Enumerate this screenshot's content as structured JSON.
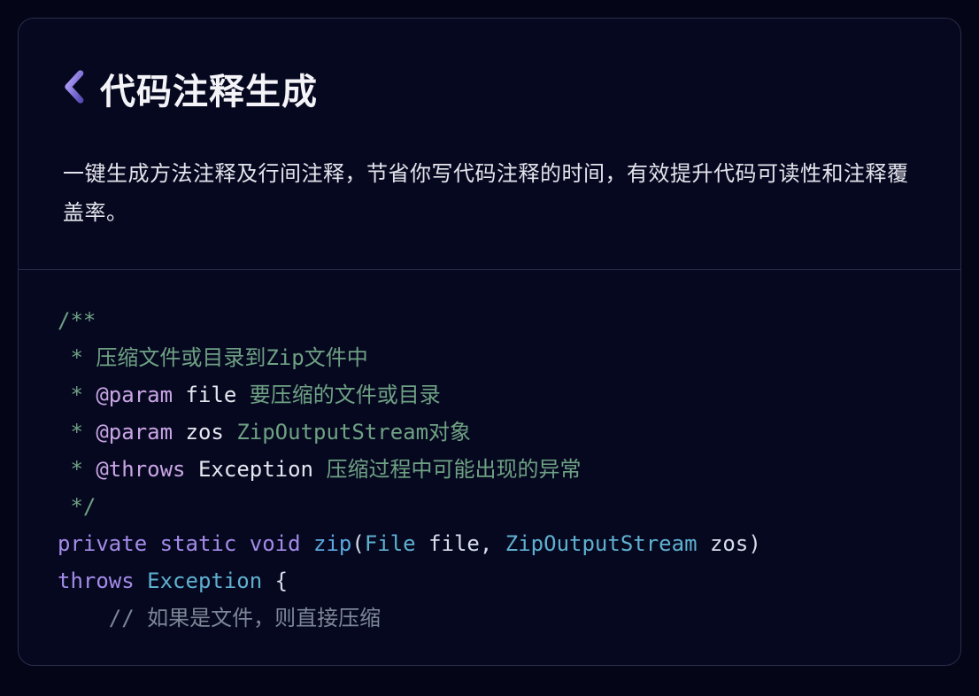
{
  "header": {
    "title": "代码注释生成",
    "description": "一键生成方法注释及行间注释，节省你写代码注释的时间，有效提升代码可读性和注释覆盖率。"
  },
  "code": {
    "l1": "/**",
    "l2_star": " * ",
    "l2_text": "压缩文件或目录到Zip文件中",
    "l3_star": " * ",
    "l3_tag": "@param",
    "l3_name": " file ",
    "l3_desc": "要压缩的文件或目录",
    "l4_star": " * ",
    "l4_tag": "@param",
    "l4_name": " zos ",
    "l4_desc": "ZipOutputStream对象",
    "l5_star": " * ",
    "l5_tag": "@throws",
    "l5_name": " Exception ",
    "l5_desc": "压缩过程中可能出现的异常",
    "l6": " */",
    "l7_kw1": "private",
    "l7_sp1": " ",
    "l7_kw2": "static",
    "l7_sp2": " ",
    "l7_kw3": "void",
    "l7_sp3": " ",
    "l7_fn": "zip",
    "l7_lp": "(",
    "l7_t1": "File",
    "l7_sp4": " ",
    "l7_v1": "file",
    "l7_cm": ", ",
    "l7_t2": "ZipOutputStream",
    "l7_sp5": " ",
    "l7_v2": "zos",
    "l7_rp": ")",
    "l8_kw": "throws",
    "l8_sp": " ",
    "l8_ex": "Exception",
    "l8_br": " {",
    "l9_indent": "    ",
    "l9_text": "// 如果是文件，则直接压缩"
  }
}
